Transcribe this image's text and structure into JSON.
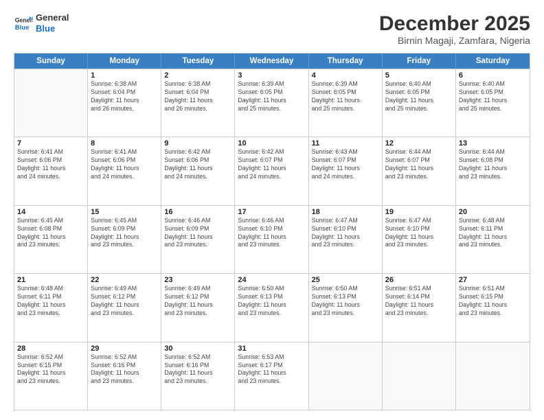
{
  "logo": {
    "line1": "General",
    "line2": "Blue"
  },
  "title": "December 2025",
  "subtitle": "Birnin Magaji, Zamfara, Nigeria",
  "header": {
    "days": [
      "Sunday",
      "Monday",
      "Tuesday",
      "Wednesday",
      "Thursday",
      "Friday",
      "Saturday"
    ]
  },
  "weeks": [
    [
      {
        "day": "",
        "text": ""
      },
      {
        "day": "1",
        "text": "Sunrise: 6:38 AM\nSunset: 6:04 PM\nDaylight: 11 hours\nand 26 minutes."
      },
      {
        "day": "2",
        "text": "Sunrise: 6:38 AM\nSunset: 6:04 PM\nDaylight: 11 hours\nand 26 minutes."
      },
      {
        "day": "3",
        "text": "Sunrise: 6:39 AM\nSunset: 6:05 PM\nDaylight: 11 hours\nand 25 minutes."
      },
      {
        "day": "4",
        "text": "Sunrise: 6:39 AM\nSunset: 6:05 PM\nDaylight: 11 hours\nand 25 minutes."
      },
      {
        "day": "5",
        "text": "Sunrise: 6:40 AM\nSunset: 6:05 PM\nDaylight: 11 hours\nand 25 minutes."
      },
      {
        "day": "6",
        "text": "Sunrise: 6:40 AM\nSunset: 6:05 PM\nDaylight: 11 hours\nand 25 minutes."
      }
    ],
    [
      {
        "day": "7",
        "text": "Sunrise: 6:41 AM\nSunset: 6:06 PM\nDaylight: 11 hours\nand 24 minutes."
      },
      {
        "day": "8",
        "text": "Sunrise: 6:41 AM\nSunset: 6:06 PM\nDaylight: 11 hours\nand 24 minutes."
      },
      {
        "day": "9",
        "text": "Sunrise: 6:42 AM\nSunset: 6:06 PM\nDaylight: 11 hours\nand 24 minutes."
      },
      {
        "day": "10",
        "text": "Sunrise: 6:42 AM\nSunset: 6:07 PM\nDaylight: 11 hours\nand 24 minutes."
      },
      {
        "day": "11",
        "text": "Sunrise: 6:43 AM\nSunset: 6:07 PM\nDaylight: 11 hours\nand 24 minutes."
      },
      {
        "day": "12",
        "text": "Sunrise: 6:44 AM\nSunset: 6:07 PM\nDaylight: 11 hours\nand 23 minutes."
      },
      {
        "day": "13",
        "text": "Sunrise: 6:44 AM\nSunset: 6:08 PM\nDaylight: 11 hours\nand 23 minutes."
      }
    ],
    [
      {
        "day": "14",
        "text": "Sunrise: 6:45 AM\nSunset: 6:08 PM\nDaylight: 11 hours\nand 23 minutes."
      },
      {
        "day": "15",
        "text": "Sunrise: 6:45 AM\nSunset: 6:09 PM\nDaylight: 11 hours\nand 23 minutes."
      },
      {
        "day": "16",
        "text": "Sunrise: 6:46 AM\nSunset: 6:09 PM\nDaylight: 11 hours\nand 23 minutes."
      },
      {
        "day": "17",
        "text": "Sunrise: 6:46 AM\nSunset: 6:10 PM\nDaylight: 11 hours\nand 23 minutes."
      },
      {
        "day": "18",
        "text": "Sunrise: 6:47 AM\nSunset: 6:10 PM\nDaylight: 11 hours\nand 23 minutes."
      },
      {
        "day": "19",
        "text": "Sunrise: 6:47 AM\nSunset: 6:10 PM\nDaylight: 11 hours\nand 23 minutes."
      },
      {
        "day": "20",
        "text": "Sunrise: 6:48 AM\nSunset: 6:11 PM\nDaylight: 11 hours\nand 23 minutes."
      }
    ],
    [
      {
        "day": "21",
        "text": "Sunrise: 6:48 AM\nSunset: 6:11 PM\nDaylight: 11 hours\nand 23 minutes."
      },
      {
        "day": "22",
        "text": "Sunrise: 6:49 AM\nSunset: 6:12 PM\nDaylight: 11 hours\nand 23 minutes."
      },
      {
        "day": "23",
        "text": "Sunrise: 6:49 AM\nSunset: 6:12 PM\nDaylight: 11 hours\nand 23 minutes."
      },
      {
        "day": "24",
        "text": "Sunrise: 6:50 AM\nSunset: 6:13 PM\nDaylight: 11 hours\nand 23 minutes."
      },
      {
        "day": "25",
        "text": "Sunrise: 6:50 AM\nSunset: 6:13 PM\nDaylight: 11 hours\nand 23 minutes."
      },
      {
        "day": "26",
        "text": "Sunrise: 6:51 AM\nSunset: 6:14 PM\nDaylight: 11 hours\nand 23 minutes."
      },
      {
        "day": "27",
        "text": "Sunrise: 6:51 AM\nSunset: 6:15 PM\nDaylight: 11 hours\nand 23 minutes."
      }
    ],
    [
      {
        "day": "28",
        "text": "Sunrise: 6:52 AM\nSunset: 6:15 PM\nDaylight: 11 hours\nand 23 minutes."
      },
      {
        "day": "29",
        "text": "Sunrise: 6:52 AM\nSunset: 6:16 PM\nDaylight: 11 hours\nand 23 minutes."
      },
      {
        "day": "30",
        "text": "Sunrise: 6:52 AM\nSunset: 6:16 PM\nDaylight: 11 hours\nand 23 minutes."
      },
      {
        "day": "31",
        "text": "Sunrise: 6:53 AM\nSunset: 6:17 PM\nDaylight: 11 hours\nand 23 minutes."
      },
      {
        "day": "",
        "text": ""
      },
      {
        "day": "",
        "text": ""
      },
      {
        "day": "",
        "text": ""
      }
    ]
  ]
}
